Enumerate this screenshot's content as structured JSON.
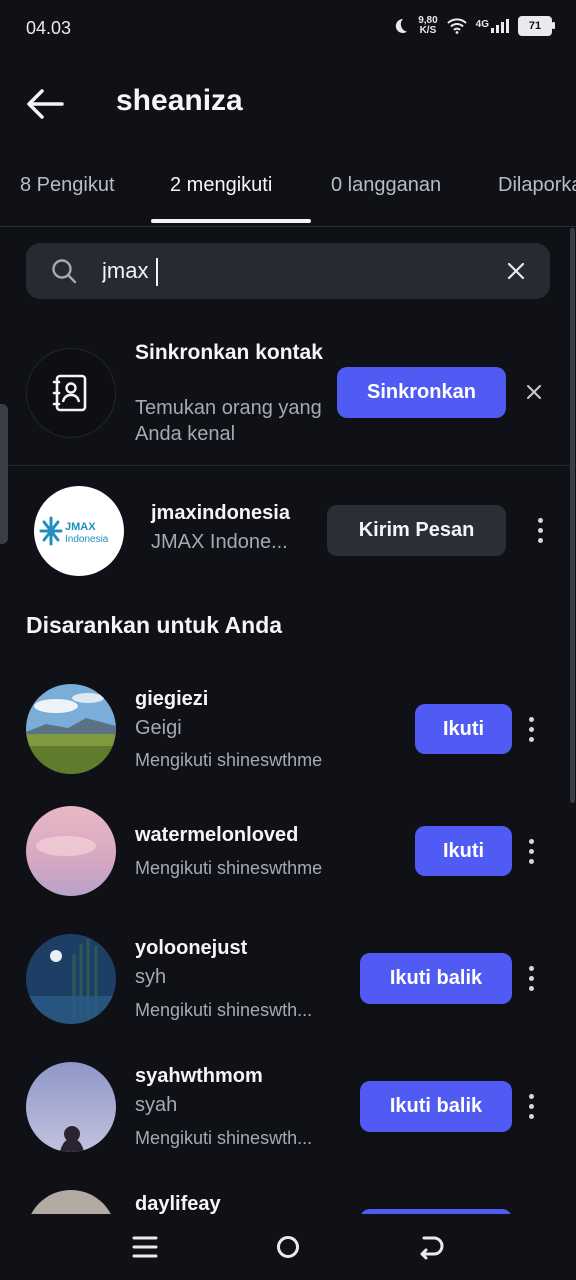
{
  "status_bar": {
    "time": "04.03",
    "net_speed_value": "9,80",
    "net_speed_unit": "K/S",
    "network": "4G",
    "battery": "71"
  },
  "header": {
    "title": "sheaniza"
  },
  "tabs": [
    {
      "label": "8 Pengikut"
    },
    {
      "label": "2 mengikuti"
    },
    {
      "label": "0 langganan"
    },
    {
      "label": "Dilaporkan"
    }
  ],
  "search": {
    "value": "jmax"
  },
  "sync": {
    "title": "Sinkronkan kontak",
    "subtitle": "Temukan orang yang Anda kenal",
    "button": "Sinkronkan"
  },
  "following": {
    "username": "jmaxindonesia",
    "display_name": "JMAX Indone...",
    "logo_top": "JMAX",
    "logo_bottom": "Indonesia",
    "button": "Kirim Pesan"
  },
  "suggested": {
    "title": "Disarankan untuk Anda",
    "items": [
      {
        "username": "giegiezi",
        "name": "Geigi",
        "meta": "Mengikuti shineswthme",
        "button": "Ikuti"
      },
      {
        "username": "watermelonloved",
        "name": "",
        "meta": "Mengikuti shineswthme",
        "button": "Ikuti"
      },
      {
        "username": "yoloonejust",
        "name": "syh",
        "meta": "Mengikuti shineswth...",
        "button": "Ikuti balik"
      },
      {
        "username": "syahwthmom",
        "name": "syah",
        "meta": "Mengikuti shineswth...",
        "button": "Ikuti balik"
      },
      {
        "username": "daylifeay",
        "name": "",
        "meta": "",
        "button": ""
      }
    ]
  },
  "colors": {
    "background": "#0f1116",
    "accent": "#4f5bf2",
    "secondary_button": "#2b2e35"
  }
}
